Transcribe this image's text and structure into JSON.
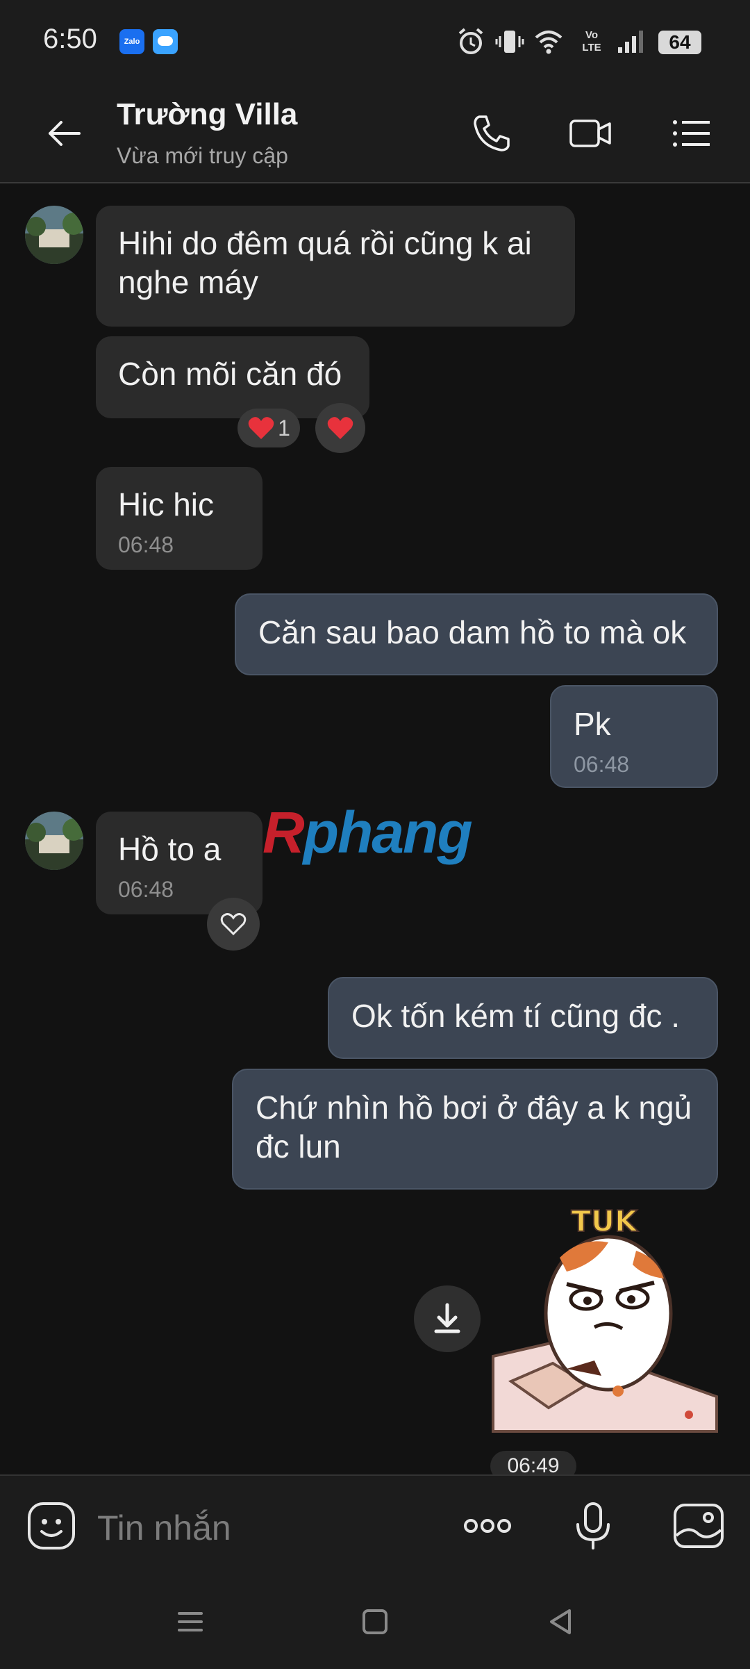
{
  "status_bar": {
    "time": "6:50",
    "app_icons": [
      "zalo-icon",
      "weather-icon"
    ],
    "right_icons": [
      "alarm-icon",
      "vibrate-icon",
      "wifi-icon",
      "volte-icon",
      "signal-icon"
    ],
    "volte_label": "Vo LTE",
    "zalo_label": "Zalo",
    "battery": "64"
  },
  "header": {
    "contact_name": "Trường Villa",
    "contact_status": "Vừa mới truy cập",
    "icons": [
      "back-arrow-icon",
      "phone-call-icon",
      "video-call-icon",
      "menu-list-icon"
    ]
  },
  "messages": [
    {
      "dir": "in",
      "text": "Hihi do đêm quá rồi cũng k ai nghe máy"
    },
    {
      "dir": "in",
      "text": "Còn mõi căn đó",
      "reaction_count": "1"
    },
    {
      "dir": "in",
      "text": "Hic hic",
      "time": "06:48"
    },
    {
      "dir": "out",
      "text": "Căn sau bao dam hồ to mà ok"
    },
    {
      "dir": "out",
      "text": "Pk",
      "time": "06:48"
    },
    {
      "dir": "in",
      "text": "Hồ to a",
      "time": "06:48"
    },
    {
      "dir": "out",
      "text": "Ok tốn kém tí cũng đc ."
    },
    {
      "dir": "out",
      "text": "Chứ nhìn hồ bơi ở đây a k ngủ đc lun"
    }
  ],
  "sticker": {
    "caption": "TÚK",
    "time": "06:49"
  },
  "watermark": {
    "part1": "R",
    "part2": "phang"
  },
  "input": {
    "placeholder": "Tin nhắn"
  },
  "colors": {
    "background": "#121212",
    "incoming": "#2b2b2b",
    "outgoing": "#3c4553",
    "heart": "#e8323c"
  }
}
